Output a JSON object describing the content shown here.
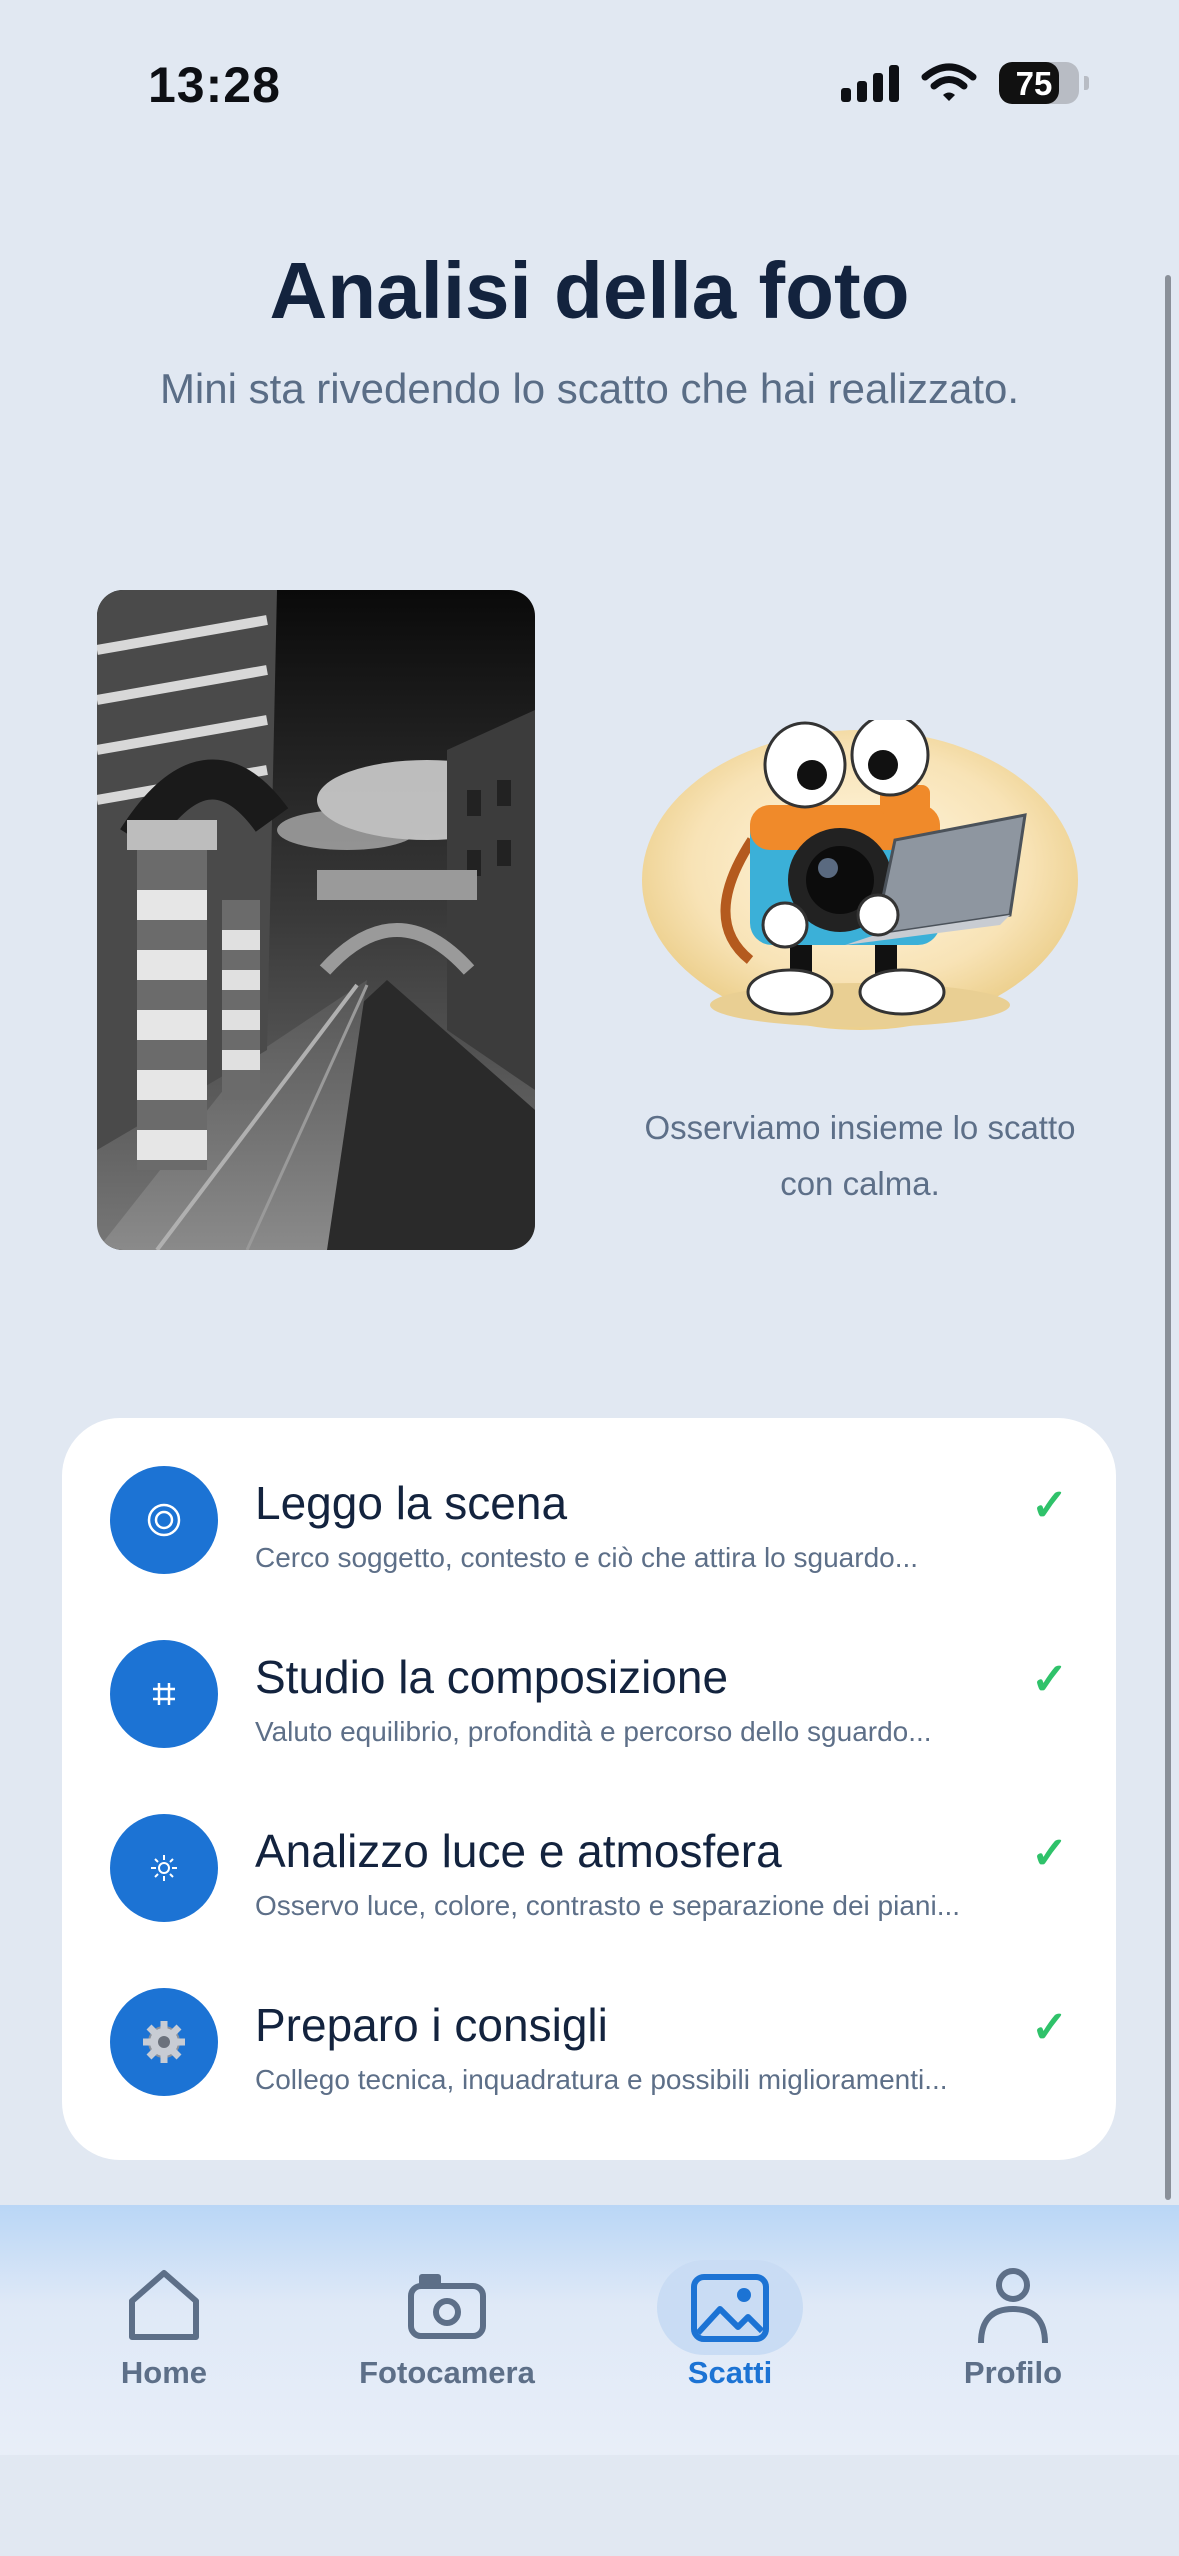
{
  "status_bar": {
    "time": "13:28",
    "battery": "75",
    "battery_level_percent": 75
  },
  "header": {
    "title": "Analisi della foto",
    "subtitle": "Mini sta rivedendo lo scatto che hai realizzato."
  },
  "mascot": {
    "caption": "Osserviamo insieme lo scatto con calma."
  },
  "steps": [
    {
      "title": "Leggo la scena",
      "description": "Cerco soggetto, contesto e ciò che attira lo sguardo...",
      "icon": "target-icon",
      "status": "completed"
    },
    {
      "title": "Studio la composizione",
      "description": "Valuto equilibrio, profondità e percorso dello sguardo...",
      "icon": "grid-icon",
      "status": "completed"
    },
    {
      "title": "Analizzo luce e atmosfera",
      "description": "Osservo luce, colore, contrasto e separazione dei piani...",
      "icon": "sun-icon",
      "status": "completed"
    },
    {
      "title": "Preparo i consigli",
      "description": "Collego tecnica, inquadratura e possibili miglioramenti...",
      "icon": "gear-icon",
      "status": "completed"
    }
  ],
  "tabs": [
    {
      "label": "Home",
      "icon": "home-icon",
      "active": false
    },
    {
      "label": "Fotocamera",
      "icon": "camera-icon",
      "active": false
    },
    {
      "label": "Scatti",
      "icon": "photo-icon",
      "active": true
    },
    {
      "label": "Profilo",
      "icon": "profile-icon",
      "active": false
    }
  ],
  "colors": {
    "accent": "#1c73d4",
    "check": "#2fc26a",
    "background": "#e1e8f2",
    "title": "#13233e"
  }
}
